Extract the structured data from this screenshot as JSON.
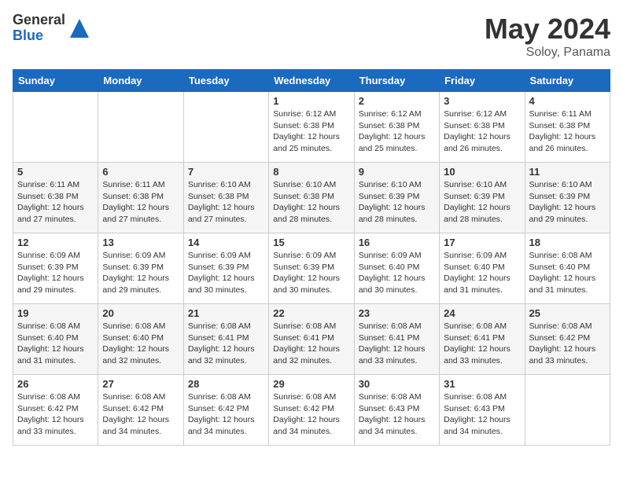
{
  "header": {
    "logo_general": "General",
    "logo_blue": "Blue",
    "title": "May 2024",
    "location": "Soloy, Panama"
  },
  "days_of_week": [
    "Sunday",
    "Monday",
    "Tuesday",
    "Wednesday",
    "Thursday",
    "Friday",
    "Saturday"
  ],
  "weeks": [
    [
      {
        "day": "",
        "info": ""
      },
      {
        "day": "",
        "info": ""
      },
      {
        "day": "",
        "info": ""
      },
      {
        "day": "1",
        "info": "Sunrise: 6:12 AM\nSunset: 6:38 PM\nDaylight: 12 hours and 25 minutes."
      },
      {
        "day": "2",
        "info": "Sunrise: 6:12 AM\nSunset: 6:38 PM\nDaylight: 12 hours and 25 minutes."
      },
      {
        "day": "3",
        "info": "Sunrise: 6:12 AM\nSunset: 6:38 PM\nDaylight: 12 hours and 26 minutes."
      },
      {
        "day": "4",
        "info": "Sunrise: 6:11 AM\nSunset: 6:38 PM\nDaylight: 12 hours and 26 minutes."
      }
    ],
    [
      {
        "day": "5",
        "info": "Sunrise: 6:11 AM\nSunset: 6:38 PM\nDaylight: 12 hours and 27 minutes."
      },
      {
        "day": "6",
        "info": "Sunrise: 6:11 AM\nSunset: 6:38 PM\nDaylight: 12 hours and 27 minutes."
      },
      {
        "day": "7",
        "info": "Sunrise: 6:10 AM\nSunset: 6:38 PM\nDaylight: 12 hours and 27 minutes."
      },
      {
        "day": "8",
        "info": "Sunrise: 6:10 AM\nSunset: 6:38 PM\nDaylight: 12 hours and 28 minutes."
      },
      {
        "day": "9",
        "info": "Sunrise: 6:10 AM\nSunset: 6:39 PM\nDaylight: 12 hours and 28 minutes."
      },
      {
        "day": "10",
        "info": "Sunrise: 6:10 AM\nSunset: 6:39 PM\nDaylight: 12 hours and 28 minutes."
      },
      {
        "day": "11",
        "info": "Sunrise: 6:10 AM\nSunset: 6:39 PM\nDaylight: 12 hours and 29 minutes."
      }
    ],
    [
      {
        "day": "12",
        "info": "Sunrise: 6:09 AM\nSunset: 6:39 PM\nDaylight: 12 hours and 29 minutes."
      },
      {
        "day": "13",
        "info": "Sunrise: 6:09 AM\nSunset: 6:39 PM\nDaylight: 12 hours and 29 minutes."
      },
      {
        "day": "14",
        "info": "Sunrise: 6:09 AM\nSunset: 6:39 PM\nDaylight: 12 hours and 30 minutes."
      },
      {
        "day": "15",
        "info": "Sunrise: 6:09 AM\nSunset: 6:39 PM\nDaylight: 12 hours and 30 minutes."
      },
      {
        "day": "16",
        "info": "Sunrise: 6:09 AM\nSunset: 6:40 PM\nDaylight: 12 hours and 30 minutes."
      },
      {
        "day": "17",
        "info": "Sunrise: 6:09 AM\nSunset: 6:40 PM\nDaylight: 12 hours and 31 minutes."
      },
      {
        "day": "18",
        "info": "Sunrise: 6:08 AM\nSunset: 6:40 PM\nDaylight: 12 hours and 31 minutes."
      }
    ],
    [
      {
        "day": "19",
        "info": "Sunrise: 6:08 AM\nSunset: 6:40 PM\nDaylight: 12 hours and 31 minutes."
      },
      {
        "day": "20",
        "info": "Sunrise: 6:08 AM\nSunset: 6:40 PM\nDaylight: 12 hours and 32 minutes."
      },
      {
        "day": "21",
        "info": "Sunrise: 6:08 AM\nSunset: 6:41 PM\nDaylight: 12 hours and 32 minutes."
      },
      {
        "day": "22",
        "info": "Sunrise: 6:08 AM\nSunset: 6:41 PM\nDaylight: 12 hours and 32 minutes."
      },
      {
        "day": "23",
        "info": "Sunrise: 6:08 AM\nSunset: 6:41 PM\nDaylight: 12 hours and 33 minutes."
      },
      {
        "day": "24",
        "info": "Sunrise: 6:08 AM\nSunset: 6:41 PM\nDaylight: 12 hours and 33 minutes."
      },
      {
        "day": "25",
        "info": "Sunrise: 6:08 AM\nSunset: 6:42 PM\nDaylight: 12 hours and 33 minutes."
      }
    ],
    [
      {
        "day": "26",
        "info": "Sunrise: 6:08 AM\nSunset: 6:42 PM\nDaylight: 12 hours and 33 minutes."
      },
      {
        "day": "27",
        "info": "Sunrise: 6:08 AM\nSunset: 6:42 PM\nDaylight: 12 hours and 34 minutes."
      },
      {
        "day": "28",
        "info": "Sunrise: 6:08 AM\nSunset: 6:42 PM\nDaylight: 12 hours and 34 minutes."
      },
      {
        "day": "29",
        "info": "Sunrise: 6:08 AM\nSunset: 6:42 PM\nDaylight: 12 hours and 34 minutes."
      },
      {
        "day": "30",
        "info": "Sunrise: 6:08 AM\nSunset: 6:43 PM\nDaylight: 12 hours and 34 minutes."
      },
      {
        "day": "31",
        "info": "Sunrise: 6:08 AM\nSunset: 6:43 PM\nDaylight: 12 hours and 34 minutes."
      },
      {
        "day": "",
        "info": ""
      }
    ]
  ]
}
